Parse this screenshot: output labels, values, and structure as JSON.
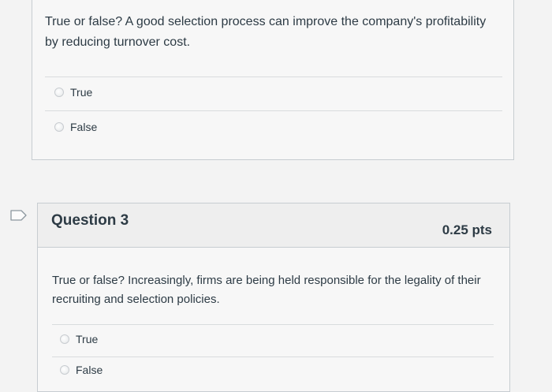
{
  "question2": {
    "text": "True or false? A good selection process can improve the company's profitability by reducing turnover cost.",
    "answers": [
      {
        "label": "True",
        "selected": false
      },
      {
        "label": "False",
        "selected": false
      }
    ]
  },
  "question3": {
    "title": "Question 3",
    "points": "0.25 pts",
    "text": "True or false? Increasingly, firms are being held responsible for the legality of their recruiting and selection policies.",
    "answers": [
      {
        "label": "True",
        "selected": false
      },
      {
        "label": "False",
        "selected": false
      }
    ]
  },
  "icons": {
    "flag": "flag-question-icon"
  }
}
